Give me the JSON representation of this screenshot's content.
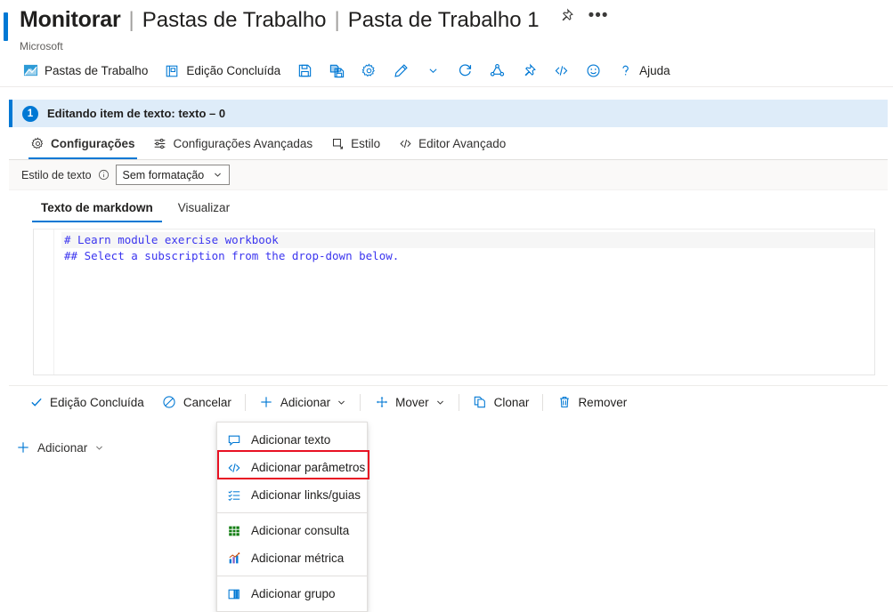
{
  "titlebar": {
    "main": "Monitorar",
    "sep": "|",
    "part2": "Pastas de Trabalho",
    "part3": "Pasta de Trabalho 1",
    "subtitle": "Microsoft",
    "pin_icon": "pin-icon",
    "more_icon": "ellipsis-icon",
    "accent_color": "#0078d4"
  },
  "commandbar": {
    "items": [
      {
        "label": "Pastas de Trabalho",
        "icon": "workbook-icon"
      },
      {
        "label": "Edição Concluída",
        "icon": "edit-done-icon"
      },
      {
        "label": "",
        "icon": "save-icon"
      },
      {
        "label": "",
        "icon": "save-as-icon"
      },
      {
        "label": "",
        "icon": "gear-icon"
      },
      {
        "label": "",
        "icon": "pencil-icon"
      },
      {
        "label": "",
        "icon": "chevron-down-icon"
      },
      {
        "label": "",
        "icon": "refresh-icon"
      },
      {
        "label": "",
        "icon": "share-icon"
      },
      {
        "label": "",
        "icon": "pin-icon"
      },
      {
        "label": "",
        "icon": "code-icon"
      },
      {
        "label": "",
        "icon": "smiley-icon"
      },
      {
        "label": "Ajuda",
        "icon": "help-icon"
      }
    ]
  },
  "banner": {
    "badge": "1",
    "text": "Editando item de texto: texto – 0",
    "background": "#deecf9",
    "border_color": "#0078d4"
  },
  "subtabs": [
    {
      "label": "Configurações",
      "icon": "gear-icon",
      "active": true
    },
    {
      "label": "Configurações Avançadas",
      "icon": "sliders-icon",
      "active": false
    },
    {
      "label": "Estilo",
      "icon": "style-icon",
      "active": false
    },
    {
      "label": "Editor Avançado",
      "icon": "code-icon",
      "active": false
    }
  ],
  "stylerow": {
    "label": "Estilo de texto",
    "info_icon": "info-icon",
    "select_value": "Sem formatação",
    "chevron_icon": "chevron-down-icon"
  },
  "editor": {
    "tabs": [
      {
        "label": "Texto de markdown",
        "active": true
      },
      {
        "label": "Visualizar",
        "active": false
      }
    ],
    "code_lines": [
      "# Learn module exercise workbook",
      "## Select a subscription from the drop-down below."
    ],
    "code_color": "#3b35ef"
  },
  "actionbar": {
    "items": [
      {
        "label": "Edição Concluída",
        "icon": "checkmark-icon",
        "divider_after": false
      },
      {
        "label": "Cancelar",
        "icon": "cancel-icon",
        "divider_after": true
      },
      {
        "label": "Adicionar",
        "icon": "plus-icon",
        "chevron": true,
        "divider_after": true
      },
      {
        "label": "Mover",
        "icon": "move-icon",
        "chevron": true,
        "divider_after": true
      },
      {
        "label": "Clonar",
        "icon": "clone-icon",
        "divider_after": true
      },
      {
        "label": "Remover",
        "icon": "trash-icon",
        "divider_after": false
      }
    ]
  },
  "menu": {
    "items": [
      {
        "label": "Adicionar texto",
        "icon": "text-bubble-icon",
        "divider_after": false
      },
      {
        "label": "Adicionar parâmetros",
        "icon": "code-icon",
        "divider_after": false,
        "highlighted": true
      },
      {
        "label": "Adicionar links/guias",
        "icon": "list-icon",
        "divider_after": true
      },
      {
        "label": "Adicionar consulta",
        "icon": "grid-icon",
        "divider_after": false
      },
      {
        "label": "Adicionar métrica",
        "icon": "chart-icon",
        "divider_after": true
      },
      {
        "label": "Adicionar grupo",
        "icon": "group-icon",
        "divider_after": false
      }
    ],
    "highlight_color": "#e81123"
  },
  "footer": {
    "add_label": "Adicionar",
    "plus_icon": "plus-icon",
    "chevron_icon": "chevron-down-icon"
  }
}
